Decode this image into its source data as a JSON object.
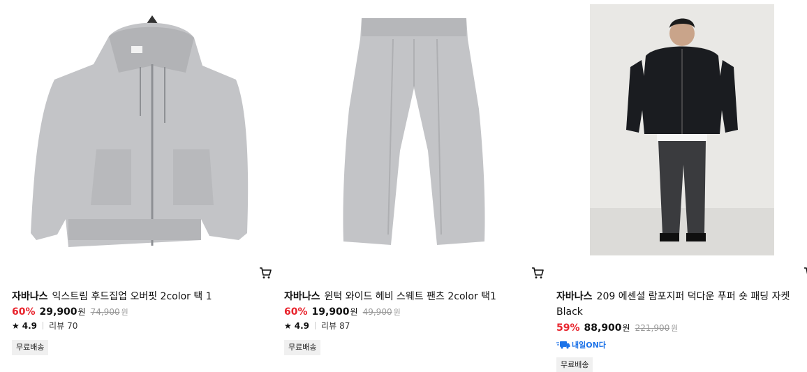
{
  "products": [
    {
      "brand": "자바나스",
      "name": "익스트림 후드집업 오버핏 2color 택 1",
      "discount": "60%",
      "price": "29,900",
      "currency": "원",
      "original_price": "74,900",
      "rating": "4.9",
      "review_label": "리뷰",
      "review_count": "70",
      "tag": "무료배송",
      "image_icon": "hoodie-image"
    },
    {
      "brand": "자바나스",
      "name": "윈턱 와이드 헤비 스웨트 팬츠 2color 택1",
      "discount": "60%",
      "price": "19,900",
      "currency": "원",
      "original_price": "49,900",
      "rating": "4.9",
      "review_label": "리뷰",
      "review_count": "87",
      "tag": "무료배송",
      "image_icon": "pants-image"
    },
    {
      "brand": "자바나스",
      "name": "209 에센셜 람포지퍼 덕다운 푸퍼 숏 패딩 자켓 Black",
      "discount": "59%",
      "price": "88,900",
      "currency": "원",
      "original_price": "221,900",
      "delivery_badge": "내일ON다",
      "tag": "무료배송",
      "image_icon": "padding-jacket-image"
    }
  ],
  "colors": {
    "discount": "#e8232c",
    "badge": "#1d73e8",
    "hoodie": "#c3c4c7",
    "jacket": "#1a1c20"
  }
}
